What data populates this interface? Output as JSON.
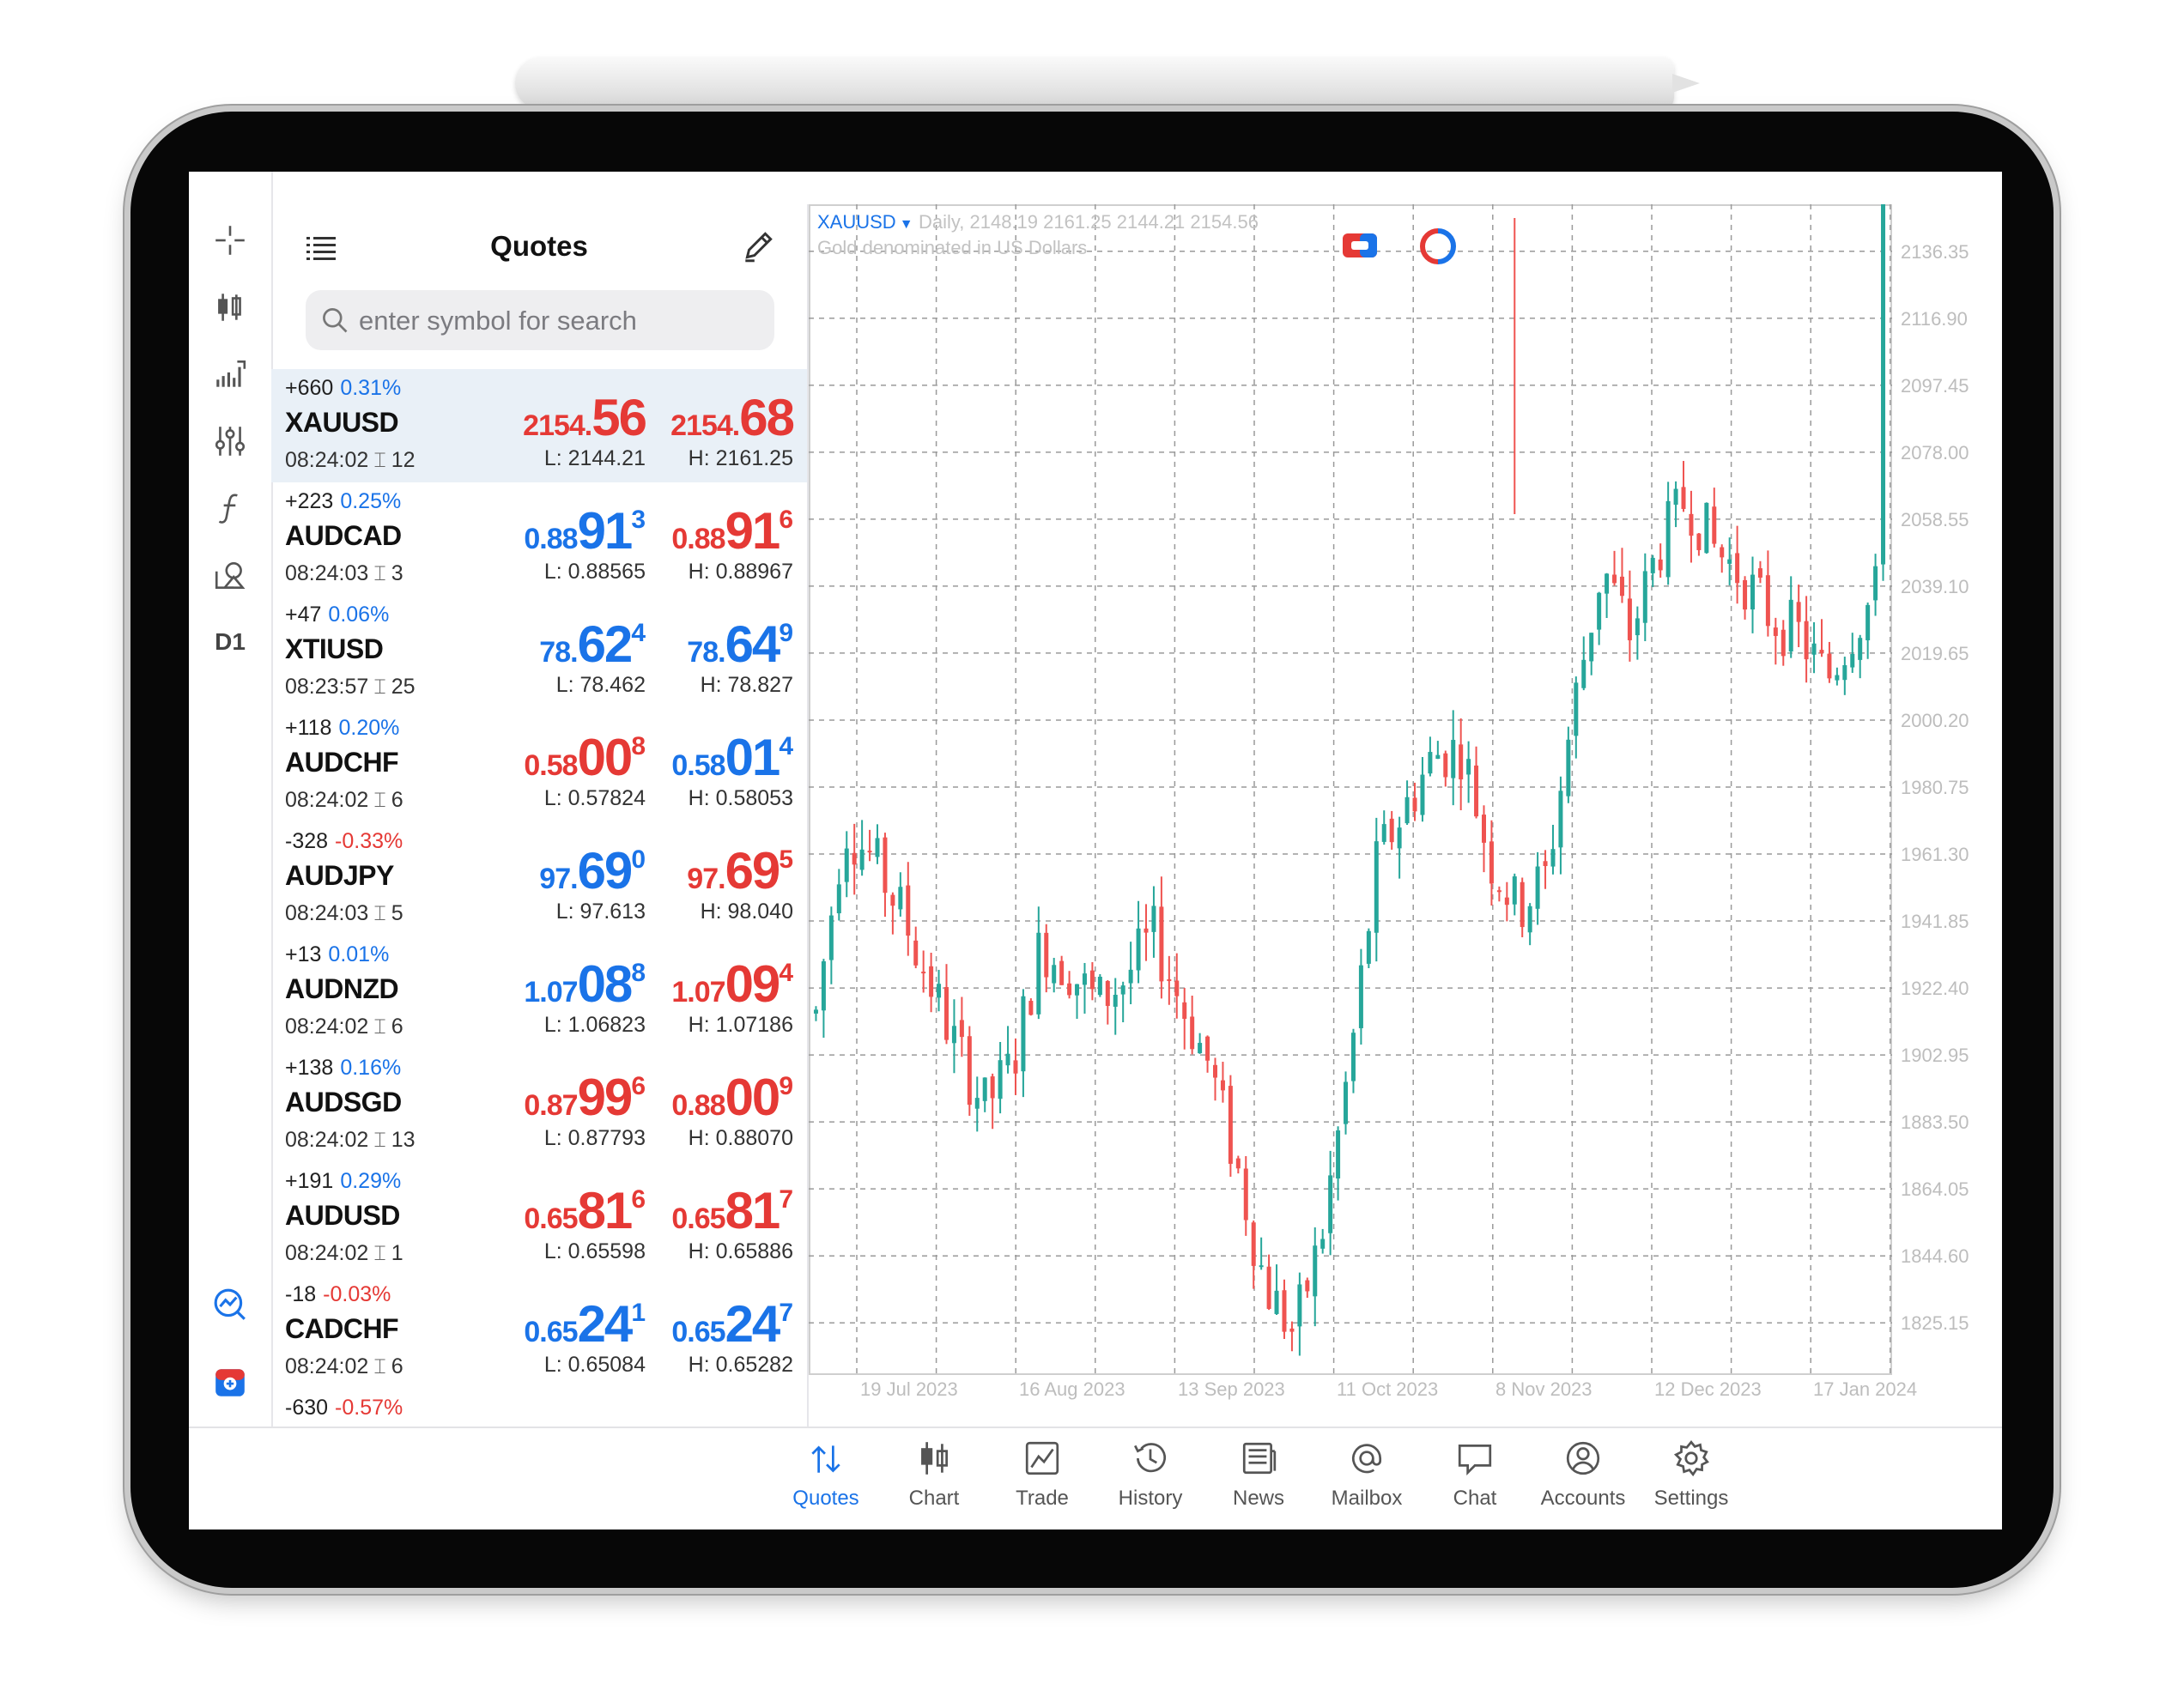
{
  "quotes_panel": {
    "title": "Quotes",
    "search_placeholder": "enter symbol for search",
    "rows": [
      {
        "symbol": "XAUUSD",
        "change": "+660",
        "percent": "0.31%",
        "percent_color": "#1a73e8",
        "time": "08:24:02",
        "spread": "12",
        "bid": {
          "small": "2154.",
          "big": "56",
          "sup": "",
          "color": "#e53935"
        },
        "ask": {
          "small": "2154.",
          "big": "68",
          "sup": "",
          "color": "#e53935"
        },
        "low": "L: 2144.21",
        "high": "H: 2161.25",
        "selected": true
      },
      {
        "symbol": "AUDCAD",
        "change": "+223",
        "percent": "0.25%",
        "percent_color": "#1a73e8",
        "time": "08:24:03",
        "spread": "3",
        "bid": {
          "small": "0.88",
          "big": "91",
          "sup": "3",
          "color": "#1a73e8"
        },
        "ask": {
          "small": "0.88",
          "big": "91",
          "sup": "6",
          "color": "#e53935"
        },
        "low": "L: 0.88565",
        "high": "H: 0.88967",
        "selected": false
      },
      {
        "symbol": "XTIUSD",
        "change": "+47",
        "percent": "0.06%",
        "percent_color": "#1a73e8",
        "time": "08:23:57",
        "spread": "25",
        "bid": {
          "small": "78.",
          "big": "62",
          "sup": "4",
          "color": "#1a73e8"
        },
        "ask": {
          "small": "78.",
          "big": "64",
          "sup": "9",
          "color": "#1a73e8"
        },
        "low": "L: 78.462",
        "high": "H: 78.827",
        "selected": false
      },
      {
        "symbol": "AUDCHF",
        "change": "+118",
        "percent": "0.20%",
        "percent_color": "#1a73e8",
        "time": "08:24:02",
        "spread": "6",
        "bid": {
          "small": "0.58",
          "big": "00",
          "sup": "8",
          "color": "#e53935"
        },
        "ask": {
          "small": "0.58",
          "big": "01",
          "sup": "4",
          "color": "#1a73e8"
        },
        "low": "L: 0.57824",
        "high": "H: 0.58053",
        "selected": false
      },
      {
        "symbol": "AUDJPY",
        "change": "-328",
        "percent": "-0.33%",
        "percent_color": "#e53935",
        "time": "08:24:03",
        "spread": "5",
        "bid": {
          "small": "97.",
          "big": "69",
          "sup": "0",
          "color": "#1a73e8"
        },
        "ask": {
          "small": "97.",
          "big": "69",
          "sup": "5",
          "color": "#e53935"
        },
        "low": "L: 97.613",
        "high": "H: 98.040",
        "selected": false
      },
      {
        "symbol": "AUDNZD",
        "change": "+13",
        "percent": "0.01%",
        "percent_color": "#1a73e8",
        "time": "08:24:02",
        "spread": "6",
        "bid": {
          "small": "1.07",
          "big": "08",
          "sup": "8",
          "color": "#1a73e8"
        },
        "ask": {
          "small": "1.07",
          "big": "09",
          "sup": "4",
          "color": "#e53935"
        },
        "low": "L: 1.06823",
        "high": "H: 1.07186",
        "selected": false
      },
      {
        "symbol": "AUDSGD",
        "change": "+138",
        "percent": "0.16%",
        "percent_color": "#1a73e8",
        "time": "08:24:02",
        "spread": "13",
        "bid": {
          "small": "0.87",
          "big": "99",
          "sup": "6",
          "color": "#e53935"
        },
        "ask": {
          "small": "0.88",
          "big": "00",
          "sup": "9",
          "color": "#e53935"
        },
        "low": "L: 0.87793",
        "high": "H: 0.88070",
        "selected": false
      },
      {
        "symbol": "AUDUSD",
        "change": "+191",
        "percent": "0.29%",
        "percent_color": "#1a73e8",
        "time": "08:24:02",
        "spread": "1",
        "bid": {
          "small": "0.65",
          "big": "81",
          "sup": "6",
          "color": "#e53935"
        },
        "ask": {
          "small": "0.65",
          "big": "81",
          "sup": "7",
          "color": "#e53935"
        },
        "low": "L: 0.65598",
        "high": "H: 0.65886",
        "selected": false
      },
      {
        "symbol": "CADCHF",
        "change": "-18",
        "percent": "-0.03%",
        "percent_color": "#e53935",
        "time": "08:24:02",
        "spread": "6",
        "bid": {
          "small": "0.65",
          "big": "24",
          "sup": "1",
          "color": "#1a73e8"
        },
        "ask": {
          "small": "0.65",
          "big": "24",
          "sup": "7",
          "color": "#1a73e8"
        },
        "low": "L: 0.65084",
        "high": "H: 0.65282",
        "selected": false
      },
      {
        "symbol": "",
        "change": "-630",
        "percent": "-0.57%",
        "percent_color": "#e53935",
        "time": "",
        "spread": "",
        "bid": {
          "small": "",
          "big": "",
          "sup": "",
          "color": "#1a73e8"
        },
        "ask": {
          "small": "",
          "big": "",
          "sup": "",
          "color": "#1a73e8"
        },
        "low": "",
        "high": "",
        "selected": false
      }
    ]
  },
  "left_toolbar": {
    "icons": [
      "crosshair-icon",
      "candlestick-icon",
      "indicators-icon",
      "settings-sliders-icon",
      "function-icon",
      "objects-icon"
    ],
    "timeframe": "D1",
    "bottom_icons": [
      "trade-signals-icon",
      "one-click-trade-icon"
    ]
  },
  "chart": {
    "symbol": "XAUUSD",
    "ohlc_text": "Daily, 2148.19 2161.25 2144.21 2154.56",
    "description": "Gold denominated in US Dollars",
    "up_color": "#26a69a",
    "down_color": "#ef5350",
    "toolbar_icons": [
      "one-click-trading-icon",
      "depth-icon"
    ]
  },
  "chart_data": {
    "type": "candlestick",
    "title": "XAUUSD",
    "timeframe": "Daily",
    "x_tick_labels": [
      "19 Jul 2023",
      "16 Aug 2023",
      "13 Sep 2023",
      "11 Oct 2023",
      "8 Nov 2023",
      "12 Dec 2023",
      "17 Jan 2024"
    ],
    "y_tick_labels": [
      "2136.35",
      "2116.90",
      "2097.45",
      "2078.00",
      "2058.55",
      "2039.10",
      "2019.65",
      "2000.20",
      "1980.75",
      "1961.30",
      "1941.85",
      "1922.40",
      "1902.95",
      "1883.50",
      "1864.05",
      "1844.60",
      "1825.15"
    ],
    "y_range": [
      1810.0,
      2150.0
    ],
    "grid": true,
    "last_candle": {
      "open": 2148.19,
      "high": 2161.25,
      "low": 2144.21,
      "close": 2154.56
    },
    "path": [
      1915,
      1970,
      1960,
      1945,
      1925,
      1905,
      1888,
      1900,
      1935,
      1928,
      1918,
      1925,
      1938,
      1918,
      1900,
      1870,
      1836,
      1822,
      1850,
      1900,
      1960,
      1975,
      1990,
      1992,
      1960,
      1945,
      1955,
      2005,
      2045,
      2025,
      2050,
      2065,
      2050,
      2042,
      2030,
      2025,
      2012,
      2028,
      2040
    ]
  },
  "tabbar": {
    "tabs": [
      {
        "label": "Quotes",
        "icon": "quotes-arrows-icon",
        "active": true
      },
      {
        "label": "Chart",
        "icon": "chart-candles-icon",
        "active": false
      },
      {
        "label": "Trade",
        "icon": "trade-line-icon",
        "active": false
      },
      {
        "label": "History",
        "icon": "history-clock-icon",
        "active": false
      },
      {
        "label": "News",
        "icon": "news-icon",
        "active": false
      },
      {
        "label": "Mailbox",
        "icon": "mailbox-at-icon",
        "active": false
      },
      {
        "label": "Chat",
        "icon": "chat-bubble-icon",
        "active": false
      },
      {
        "label": "Accounts",
        "icon": "account-icon",
        "active": false
      },
      {
        "label": "Settings",
        "icon": "settings-gear-icon",
        "active": false
      }
    ]
  }
}
